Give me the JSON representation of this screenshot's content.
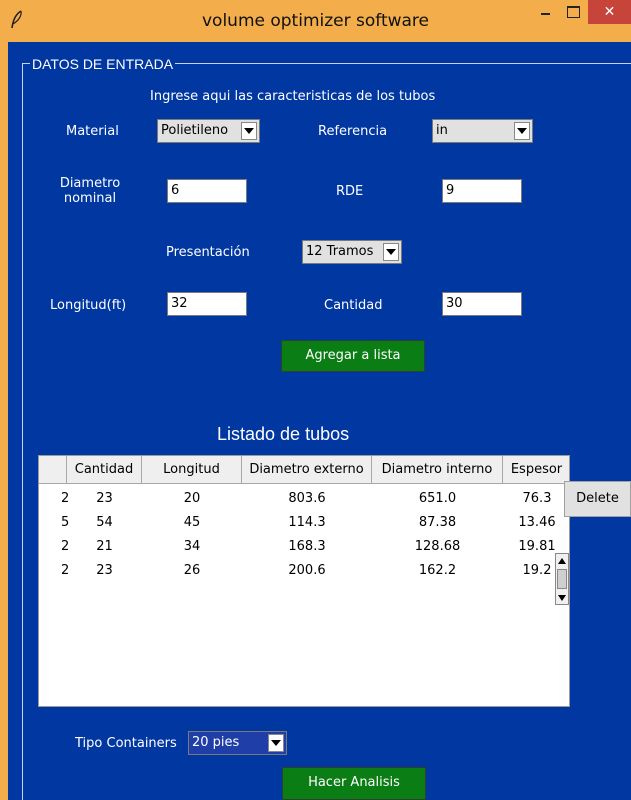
{
  "window": {
    "title": "volume optimizer software",
    "icon": "feather-icon",
    "close_glyph": "✕"
  },
  "frame": {
    "label": "DATOS DE ENTRADA"
  },
  "instructions": "Ingrese aqui las caracteristicas de los tubos",
  "form": {
    "material_label": "Material",
    "material_value": "Polietileno",
    "referencia_label": "Referencia",
    "referencia_value": "in",
    "diametro_label_1": "Diametro",
    "diametro_label_2": "nominal",
    "diametro_value": "6",
    "rde_label": "RDE",
    "rde_value": "9",
    "presentacion_label": "Presentación",
    "presentacion_value": "12 Tramos",
    "longitud_label": "Longitud(ft)",
    "longitud_value": "32",
    "cantidad_label": "Cantidad",
    "cantidad_value": "30",
    "add_button": "Agregar a lista"
  },
  "list": {
    "title": "Listado de tubos",
    "columns": [
      "",
      "Cantidad",
      "Longitud",
      "Diametro externo",
      "Diametro interno",
      "Espesor"
    ],
    "rows": [
      {
        "mark": "2",
        "cantidad": "23",
        "longitud": "20",
        "ext": "803.6",
        "int": "651.0",
        "esp": "76.3"
      },
      {
        "mark": "5",
        "cantidad": "54",
        "longitud": "45",
        "ext": "114.3",
        "int": "87.38",
        "esp": "13.46"
      },
      {
        "mark": "2",
        "cantidad": "21",
        "longitud": "34",
        "ext": "168.3",
        "int": "128.68",
        "esp": "19.81"
      },
      {
        "mark": "2",
        "cantidad": "23",
        "longitud": "26",
        "ext": "200.6",
        "int": "162.2",
        "esp": "19.2"
      }
    ],
    "delete_button": "Delete"
  },
  "containers": {
    "label": "Tipo Containers",
    "value": "20 pies"
  },
  "analyze_button": "Hacer Analisis",
  "colors": {
    "title_bar": "#f3ad4a",
    "background": "#0037a1",
    "green_button": "#0a7d14",
    "close_button": "#c7443b"
  }
}
